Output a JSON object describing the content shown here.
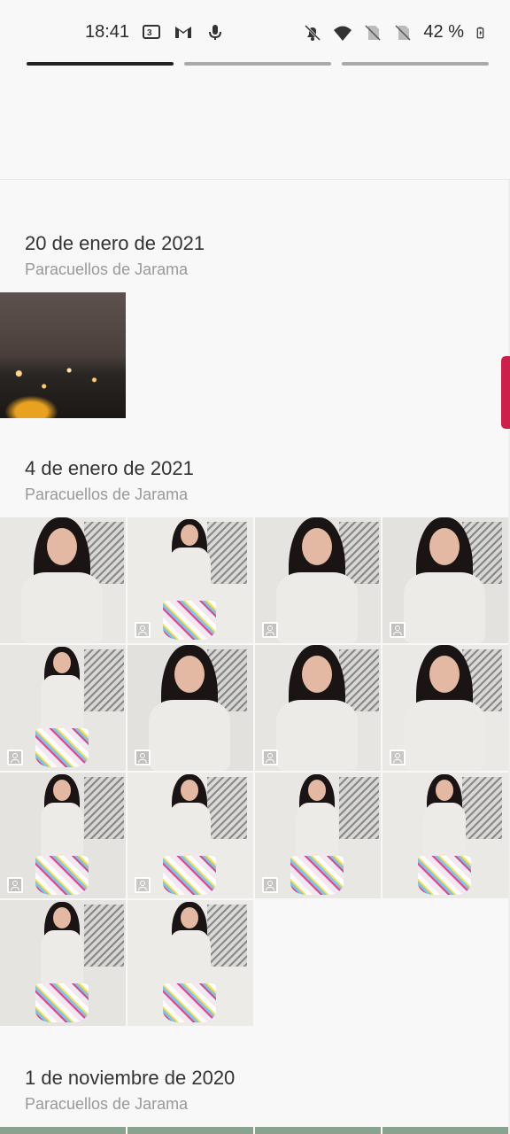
{
  "status_bar": {
    "time": "18:41",
    "battery": "42 %",
    "icons": [
      "3-icon",
      "gmail-icon",
      "mic-icon",
      "mute-icon",
      "wifi-icon",
      "no-sim-icon",
      "no-sim-icon",
      "battery-icon"
    ]
  },
  "sections": [
    {
      "date": "20 de enero de 2021",
      "location": "Paracuellos de Jarama"
    },
    {
      "date": "4 de enero de 2021",
      "location": "Paracuellos de Jarama"
    },
    {
      "date": "1 de noviembre de 2020",
      "location": "Paracuellos de Jarama"
    }
  ],
  "accent_color": "#cc1f4b"
}
